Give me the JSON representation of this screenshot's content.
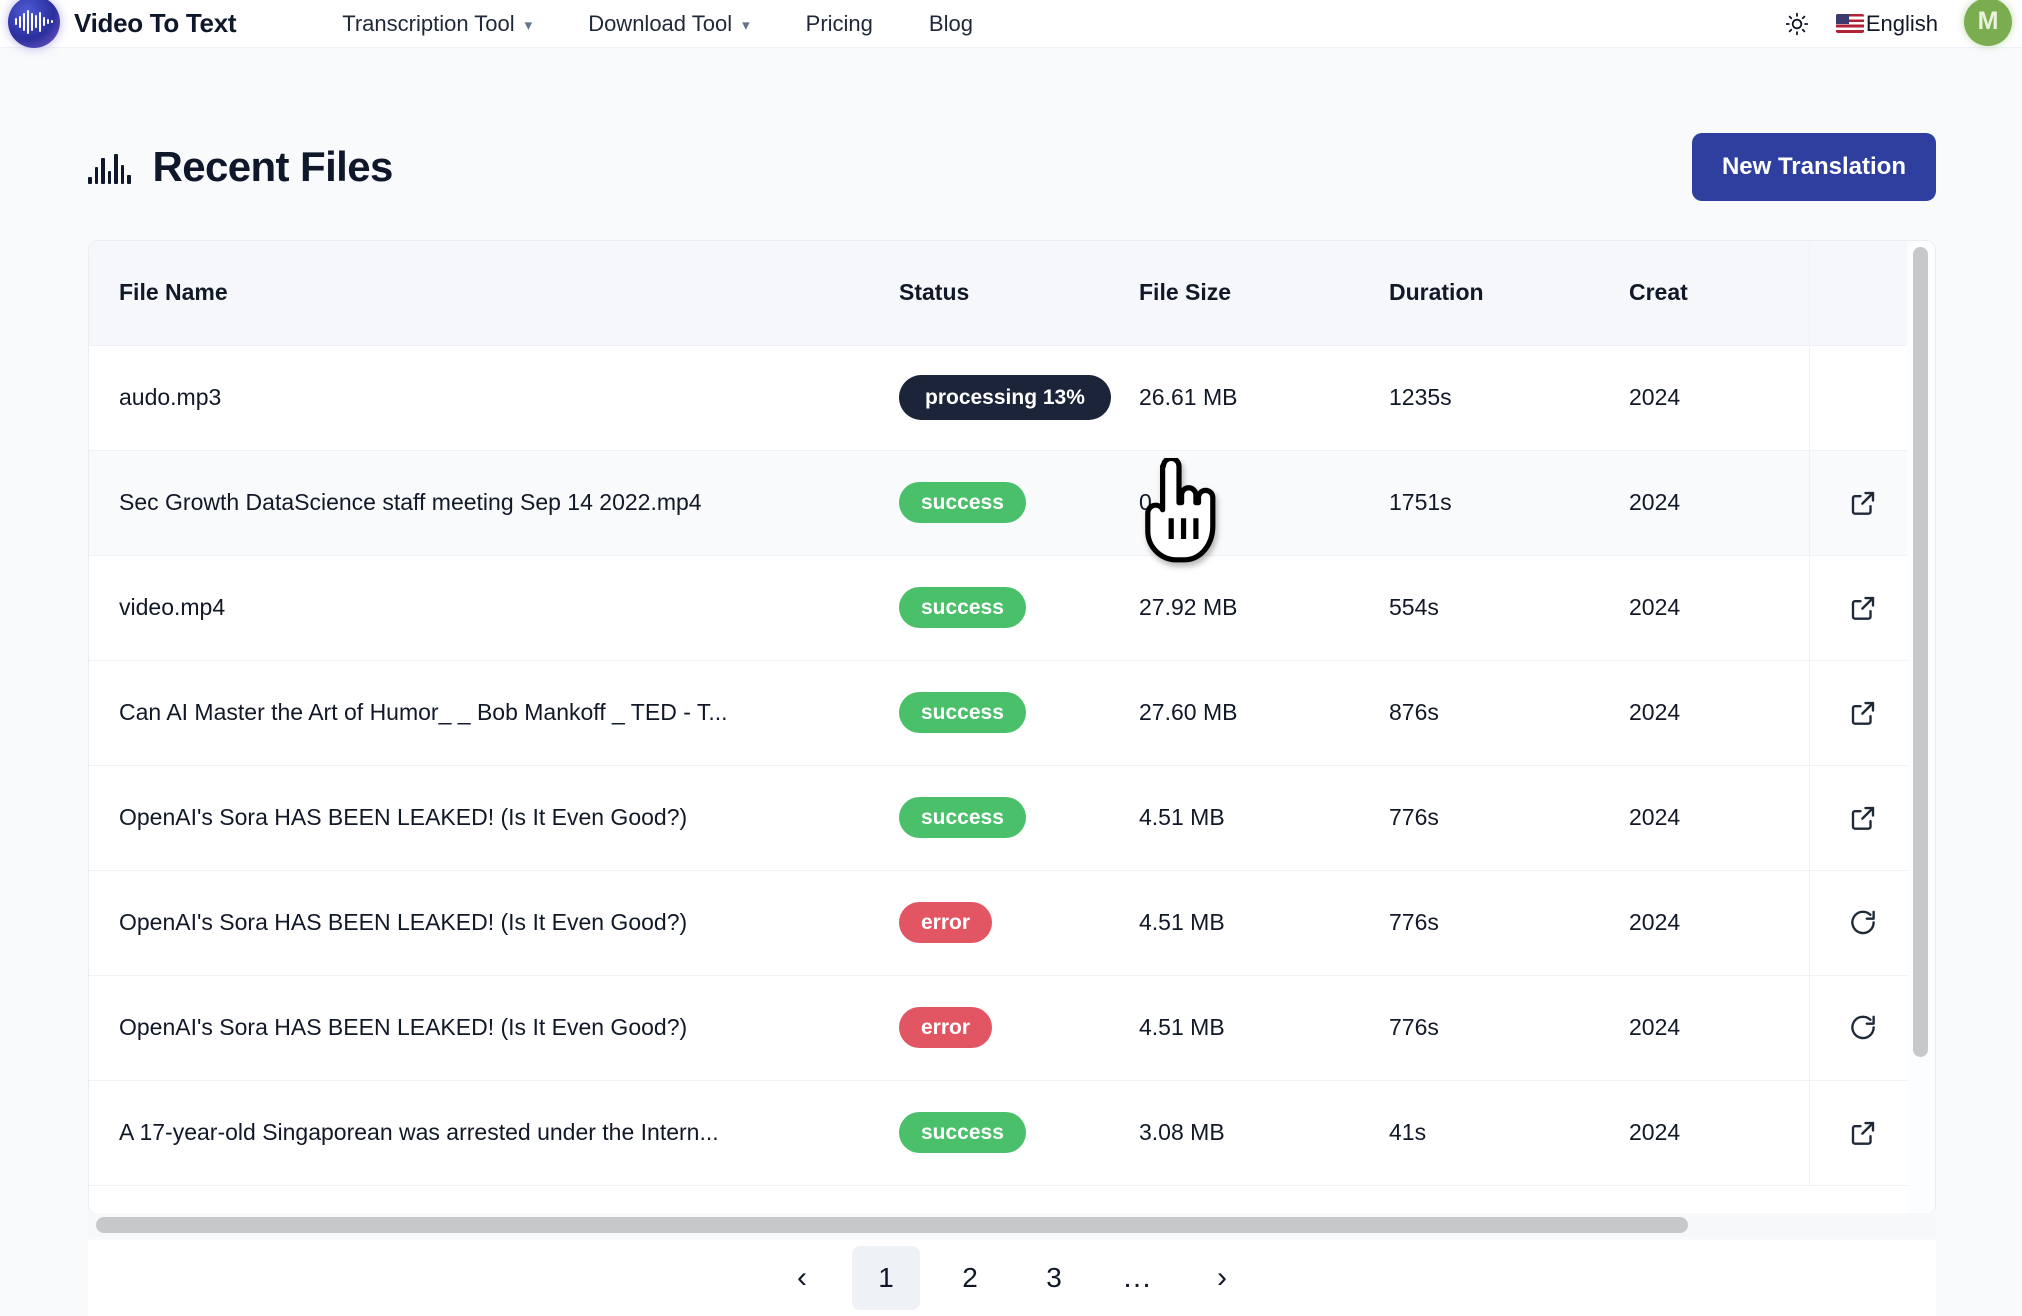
{
  "header": {
    "brand": "Video To Text",
    "logo_icon": "waveform-logo-icon",
    "nav": [
      {
        "label": "Transcription Tool",
        "has_caret": true
      },
      {
        "label": "Download Tool",
        "has_caret": true
      },
      {
        "label": "Pricing",
        "has_caret": false
      },
      {
        "label": "Blog",
        "has_caret": false
      }
    ],
    "theme_toggle_icon": "sun-icon",
    "language": "English",
    "language_flag": "us-flag-icon",
    "avatar_initial": "M"
  },
  "page": {
    "title": "Recent Files",
    "title_icon": "audio-waveform-icon",
    "new_translation_label": "New Translation"
  },
  "table": {
    "columns": [
      "File Name",
      "Status",
      "File Size",
      "Duration",
      "Creat"
    ],
    "rows": [
      {
        "name": "audo.mp3",
        "status": "processing 13%",
        "status_kind": "processing",
        "size": "26.61 MB",
        "duration": "1235s",
        "created": "2024",
        "has_open": false,
        "has_retry": false
      },
      {
        "name": "Sec Growth DataScience staff meeting Sep 14 2022.mp4",
        "status": "success",
        "status_kind": "success",
        "size": "0 MB",
        "duration": "1751s",
        "created": "2024",
        "has_open": true,
        "has_retry": false
      },
      {
        "name": "video.mp4",
        "status": "success",
        "status_kind": "success",
        "size": "27.92 MB",
        "duration": "554s",
        "created": "2024",
        "has_open": true,
        "has_retry": false
      },
      {
        "name": "Can AI Master the Art of Humor_ _ Bob Mankoff _ TED - T...",
        "status": "success",
        "status_kind": "success",
        "size": "27.60 MB",
        "duration": "876s",
        "created": "2024",
        "has_open": true,
        "has_retry": false
      },
      {
        "name": "OpenAI's Sora HAS BEEN LEAKED! (Is It Even Good?)",
        "status": "success",
        "status_kind": "success",
        "size": "4.51 MB",
        "duration": "776s",
        "created": "2024",
        "has_open": true,
        "has_retry": false
      },
      {
        "name": "OpenAI's Sora HAS BEEN LEAKED! (Is It Even Good?)",
        "status": "error",
        "status_kind": "error",
        "size": "4.51 MB",
        "duration": "776s",
        "created": "2024",
        "has_open": false,
        "has_retry": true
      },
      {
        "name": "OpenAI's Sora HAS BEEN LEAKED! (Is It Even Good?)",
        "status": "error",
        "status_kind": "error",
        "size": "4.51 MB",
        "duration": "776s",
        "created": "2024",
        "has_open": false,
        "has_retry": true
      },
      {
        "name": "A 17-year-old Singaporean was arrested under the Intern...",
        "status": "success",
        "status_kind": "success",
        "size": "3.08 MB",
        "duration": "41s",
        "created": "2024",
        "has_open": true,
        "has_retry": false
      }
    ]
  },
  "pagination": {
    "prev": "‹",
    "pages": [
      "1",
      "2",
      "3"
    ],
    "ellipsis": "…",
    "next": "›",
    "current": "1"
  },
  "colors": {
    "accent_button": "#2f3fa0",
    "success_badge": "#4ac06a",
    "error_badge": "#e25563",
    "processing_badge": "#1b2438",
    "avatar": "#7aad4f",
    "page_bg": "#f8fafc"
  }
}
